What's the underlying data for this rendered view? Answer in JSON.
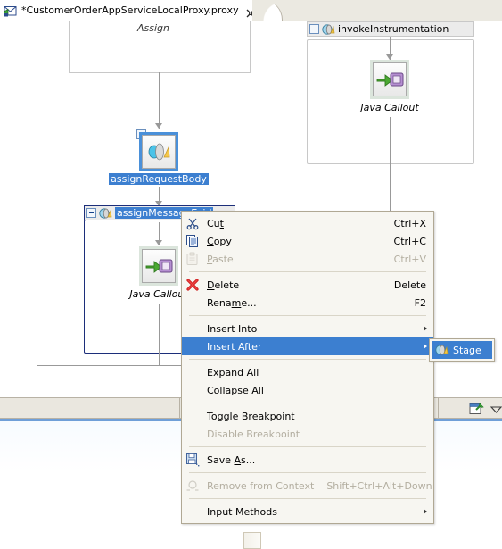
{
  "editor": {
    "tab": {
      "label": "*CustomerOrderAppServiceLocalProxy.proxy",
      "icon": "proxy-file-icon",
      "close_icon": "close-icon"
    }
  },
  "canvas": {
    "scopes": [
      {
        "title": "Assign"
      }
    ],
    "nodes": [
      {
        "id": "assignRequestBody",
        "caption": "assignRequestBody",
        "icon": "assign-activity-icon",
        "expander": "plus",
        "selected": true
      },
      {
        "id": "java-callout-right",
        "caption": "Java Callout",
        "icon": "java-callout-icon",
        "selected": false
      },
      {
        "id": "java-callout-left",
        "caption": "Java Callout",
        "icon": "java-callout-icon",
        "selected": false
      }
    ],
    "flows": [
      {
        "id": "invokeInstrumentation",
        "header_label": "invokeInstrumentation",
        "header_icon": "stage-icon",
        "expander": "minus",
        "header_highlighted": false
      },
      {
        "id": "assignMessageEcid",
        "header_label": "assignMessageEcid",
        "header_icon": "stage-icon",
        "expander": "minus",
        "header_highlighted": true
      }
    ]
  },
  "context_menu": {
    "groups": [
      {
        "items": [
          {
            "label": "Cut",
            "mnemonic": "t",
            "shortcut": "Ctrl+X",
            "icon": "cut-icon",
            "enabled": true,
            "selected": false,
            "submenu": false
          },
          {
            "label": "Copy",
            "mnemonic": "C",
            "shortcut": "Ctrl+C",
            "icon": "copy-icon",
            "enabled": true,
            "selected": false,
            "submenu": false
          },
          {
            "label": "Paste",
            "mnemonic": "P",
            "shortcut": "Ctrl+V",
            "icon": "paste-icon",
            "enabled": false,
            "selected": false,
            "submenu": false
          }
        ]
      },
      {
        "items": [
          {
            "label": "Delete",
            "mnemonic": "D",
            "shortcut": "Delete",
            "icon": "delete-icon",
            "enabled": true,
            "selected": false,
            "submenu": false
          },
          {
            "label": "Rename...",
            "mnemonic": "m",
            "shortcut": "F2",
            "icon": "",
            "enabled": true,
            "selected": false,
            "submenu": false
          }
        ]
      },
      {
        "items": [
          {
            "label": "Insert Into",
            "mnemonic": "",
            "shortcut": "",
            "icon": "",
            "enabled": true,
            "selected": false,
            "submenu": true
          },
          {
            "label": "Insert After",
            "mnemonic": "",
            "shortcut": "",
            "icon": "",
            "enabled": true,
            "selected": true,
            "submenu": true
          }
        ]
      },
      {
        "items": [
          {
            "label": "Expand All",
            "mnemonic": "",
            "shortcut": "",
            "icon": "",
            "enabled": true,
            "selected": false,
            "submenu": false
          },
          {
            "label": "Collapse All",
            "mnemonic": "",
            "shortcut": "",
            "icon": "",
            "enabled": true,
            "selected": false,
            "submenu": false
          }
        ]
      },
      {
        "items": [
          {
            "label": "Toggle Breakpoint",
            "mnemonic": "",
            "shortcut": "",
            "icon": "",
            "enabled": true,
            "selected": false,
            "submenu": false
          },
          {
            "label": "Disable Breakpoint",
            "mnemonic": "",
            "shortcut": "",
            "icon": "",
            "enabled": false,
            "selected": false,
            "submenu": false
          }
        ]
      },
      {
        "items": [
          {
            "label": "Save As...",
            "mnemonic": "A",
            "shortcut": "",
            "icon": "save-as-icon",
            "enabled": true,
            "selected": false,
            "submenu": false
          }
        ]
      },
      {
        "items": [
          {
            "label": "Remove from Context",
            "mnemonic": "",
            "shortcut": "Shift+Ctrl+Alt+Down",
            "icon": "remove-from-context-icon",
            "enabled": false,
            "selected": false,
            "submenu": false
          }
        ]
      },
      {
        "items": [
          {
            "label": "Input Methods",
            "mnemonic": "",
            "shortcut": "",
            "icon": "",
            "enabled": true,
            "selected": false,
            "submenu": true
          }
        ]
      }
    ]
  },
  "submenu": {
    "items": [
      {
        "label": "Stage",
        "icon": "stage-icon",
        "selected": true
      }
    ]
  },
  "bottom_panel": {
    "toolbar_icons": [
      {
        "name": "pin-view-icon"
      },
      {
        "name": "view-menu-icon"
      }
    ]
  },
  "colors": {
    "selection_blue": "#3c7fd0",
    "menu_bg": "#f7f6f1",
    "menu_border": "#b0a894",
    "tabbar_bg": "#ebe9e1",
    "panel_accent": "#6f9fd8",
    "disabled_text": "#b3aea0"
  }
}
